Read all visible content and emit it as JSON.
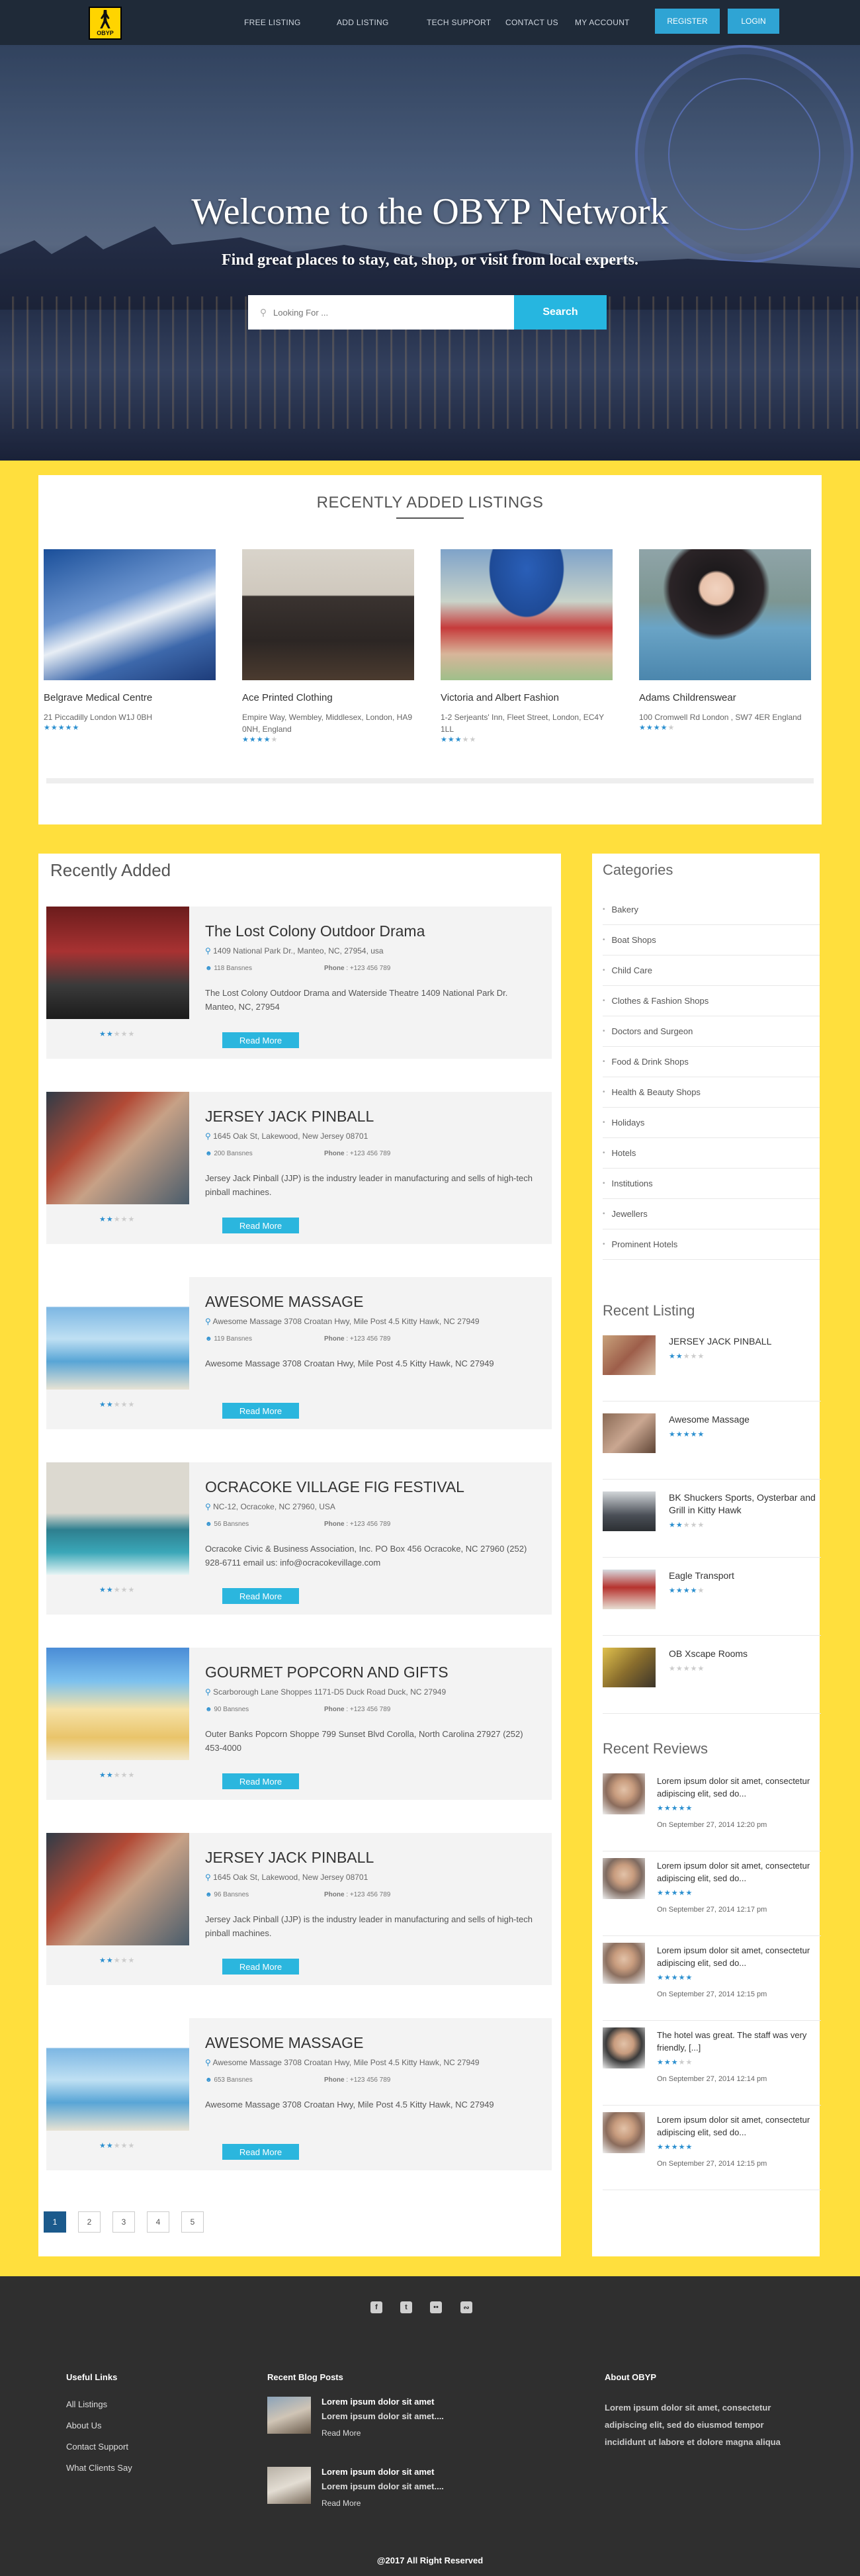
{
  "brand": {
    "logo_text": "OBYP"
  },
  "nav": {
    "links": [
      "FREE LISTING",
      "ADD LISTING",
      "TECH SUPPORT",
      "CONTACT US",
      "MY ACCOUNT"
    ],
    "register": "REGISTER",
    "login": "LOGIN"
  },
  "hero": {
    "title": "Welcome to the OBYP Network",
    "subtitle": "Find great places to stay, eat, shop, or visit from local experts.",
    "search_placeholder": "Looking For ...",
    "search_button": "Search"
  },
  "recent_listings": {
    "title": "RECENTLY ADDED LISTINGS",
    "cards": [
      {
        "name": "Belgrave Medical Centre",
        "address": "21 Piccadilly London W1J 0BH",
        "rating": 5
      },
      {
        "name": "Ace Printed Clothing",
        "address": "Empire Way, Wembley, Middlesex, London, HA9 0NH, England",
        "rating": 4
      },
      {
        "name": "Victoria and Albert Fashion",
        "address": "1-2 Serjeants' Inn, Fleet Street, London, EC4Y 1LL",
        "rating": 3
      },
      {
        "name": "Adams Childrenswear",
        "address": "100 Cromwell Rd London , SW7 4ER England",
        "rating": 4
      }
    ]
  },
  "recently_added": {
    "title": "Recently Added",
    "read_more": "Read More",
    "phone_label": "Phone",
    "items": [
      {
        "title": "The Lost Colony Outdoor Drama",
        "address": "1409 National Park Dr., Manteo, NC, 27954, usa",
        "views": "118 Bansnes",
        "phone": "+123 456 789",
        "desc": "The Lost Colony Outdoor Drama and Waterside Theatre 1409 National Park Dr. Manteo, NC, 27954",
        "rating": 2
      },
      {
        "title": "JERSEY JACK PINBALL",
        "address": "1645 Oak St, Lakewood, New Jersey 08701",
        "views": "200 Bansnes",
        "phone": "+123 456 789",
        "desc": "Jersey Jack Pinball (JJP) is the industry leader in manufacturing and sells of high-tech pinball machines.",
        "rating": 2
      },
      {
        "title": "AWESOME MASSAGE",
        "address": "Awesome Massage 3708 Croatan Hwy, Mile Post 4.5 Kitty Hawk, NC 27949",
        "views": "119 Bansnes",
        "phone": "+123 456 789",
        "desc": "Awesome Massage 3708 Croatan Hwy, Mile Post 4.5 Kitty Hawk, NC 27949",
        "rating": 2
      },
      {
        "title": "OCRACOKE VILLAGE FIG FESTIVAL",
        "address": "NC-12, Ocracoke, NC 27960, USA",
        "views": "56 Bansnes",
        "phone": "+123 456 789",
        "desc": "Ocracoke Civic & Business Association, Inc. PO Box 456 Ocracoke, NC 27960 (252) 928-6711 email us: info@ocracokevillage.com",
        "rating": 2
      },
      {
        "title": "GOURMET POPCORN AND GIFTS",
        "address": "Scarborough Lane Shoppes 1171-D5 Duck Road Duck, NC 27949",
        "views": "90 Bansnes",
        "phone": "+123 456 789",
        "desc": "Outer Banks Popcorn Shoppe 799 Sunset Blvd Corolla, North Carolina 27927 (252) 453-4000",
        "rating": 2
      },
      {
        "title": "JERSEY JACK PINBALL",
        "address": "1645 Oak St, Lakewood, New Jersey 08701",
        "views": "96 Bansnes",
        "phone": "+123 456 789",
        "desc": "Jersey Jack Pinball (JJP) is the industry leader in manufacturing and sells of high-tech pinball machines.",
        "rating": 2
      },
      {
        "title": "AWESOME MASSAGE",
        "address": "Awesome Massage 3708 Croatan Hwy, Mile Post 4.5 Kitty Hawk, NC 27949",
        "views": "653 Bansnes",
        "phone": "+123 456 789",
        "desc": "Awesome Massage 3708 Croatan Hwy, Mile Post 4.5 Kitty Hawk, NC 27949",
        "rating": 2
      }
    ],
    "pages": [
      "1",
      "2",
      "3",
      "4",
      "5"
    ]
  },
  "sidebar": {
    "categories_title": "Categories",
    "categories": [
      "Bakery",
      "Boat Shops",
      "Child Care",
      "Clothes & Fashion Shops",
      "Doctors and Surgeon",
      "Food & Drink Shops",
      "Health & Beauty Shops",
      "Holidays",
      "Hotels",
      "Institutions",
      "Jewellers",
      "Prominent Hotels"
    ],
    "recent_listing_title": "Recent Listing",
    "recent_listing": [
      {
        "title": "JERSEY JACK PINBALL",
        "rating": 2
      },
      {
        "title": "Awesome Massage",
        "rating": 5
      },
      {
        "title": "BK Shuckers Sports, Oysterbar and Grill in Kitty Hawk",
        "rating": 2
      },
      {
        "title": "Eagle Transport",
        "rating": 4
      },
      {
        "title": "OB Xscape Rooms",
        "rating": 0
      }
    ],
    "recent_reviews_title": "Recent Reviews",
    "recent_reviews": [
      {
        "text": "Lorem ipsum dolor sit amet, consectetur adipiscing elit, sed do...",
        "date": "On September 27, 2014 12:20 pm",
        "rating": 5
      },
      {
        "text": "Lorem ipsum dolor sit amet, consectetur adipiscing elit, sed do...",
        "date": "On September 27, 2014 12:17 pm",
        "rating": 5
      },
      {
        "text": "Lorem ipsum dolor sit amet, consectetur adipiscing elit, sed do...",
        "date": "On September 27, 2014 12:15 pm",
        "rating": 5
      },
      {
        "text": "The hotel was great. The staff was very friendly, [...]",
        "date": "On September 27, 2014 12:14 pm",
        "rating": 3
      },
      {
        "text": "Lorem ipsum dolor sit amet, consectetur adipiscing elit, sed do...",
        "date": "On September 27, 2014 12:15 pm",
        "rating": 5
      }
    ]
  },
  "footer": {
    "useful_links_title": "Useful Links",
    "useful_links": [
      "All Listings",
      "About Us",
      "Contact Support",
      "What Clients Say"
    ],
    "blog_title": "Recent Blog Posts",
    "blog_posts": [
      {
        "title": "Lorem ipsum dolor sit amet",
        "excerpt": "Lorem ipsum dolor sit amet....",
        "link": "Read More"
      },
      {
        "title": "Lorem ipsum dolor sit amet",
        "excerpt": "Lorem ipsum dolor sit amet....",
        "link": "Read More"
      }
    ],
    "about_title": "About OBYP",
    "about_text": "Lorem ipsum dolor sit amet, consectetur adipiscing elit, sed do eiusmod tempor incididunt ut labore et dolore magna aliqua",
    "copyright": "@2017 All Right Reserved",
    "social_icons": [
      "facebook-icon",
      "twitter-icon",
      "flickr-icon",
      "rss-icon"
    ]
  },
  "colors": {
    "accent": "#2bb6de",
    "page_bg": "#ffdf3d",
    "nav_bg": "#1f2a38",
    "footer_bg": "#2f2f2f",
    "star": "#2b8fcf"
  }
}
